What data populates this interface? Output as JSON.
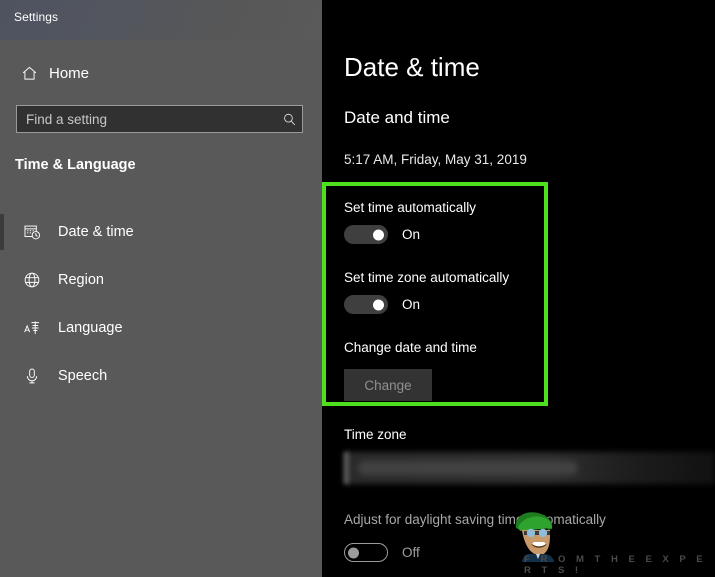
{
  "window": {
    "title": "Settings"
  },
  "sidebar": {
    "home_label": "Home",
    "home_icon": "home-icon",
    "search": {
      "placeholder": "Find a setting",
      "value": "",
      "icon": "search-icon"
    },
    "section_title": "Time & Language",
    "items": [
      {
        "label": "Date & time",
        "icon": "calendar-clock-icon",
        "selected": true
      },
      {
        "label": "Region",
        "icon": "globe-icon",
        "selected": false
      },
      {
        "label": "Language",
        "icon": "language-icon",
        "selected": false
      },
      {
        "label": "Speech",
        "icon": "microphone-icon",
        "selected": false
      }
    ]
  },
  "main": {
    "page_title": "Date & time",
    "sub_heading": "Date and time",
    "current_datetime": "5:17 AM, Friday, May 31, 2019",
    "set_time_auto": {
      "label": "Set time automatically",
      "state": "On"
    },
    "set_timezone_auto": {
      "label": "Set time zone automatically",
      "state": "On"
    },
    "change_datetime": {
      "label": "Change date and time",
      "button": "Change"
    },
    "time_zone": {
      "label": "Time zone",
      "value": ""
    },
    "daylight_saving": {
      "label": "Adjust for daylight saving time automatically",
      "state": "Off"
    }
  },
  "annotation": {
    "highlight_color": "#4ee01d"
  },
  "watermark": {
    "text": "F R O M   T H E   E X P E R T S !"
  }
}
